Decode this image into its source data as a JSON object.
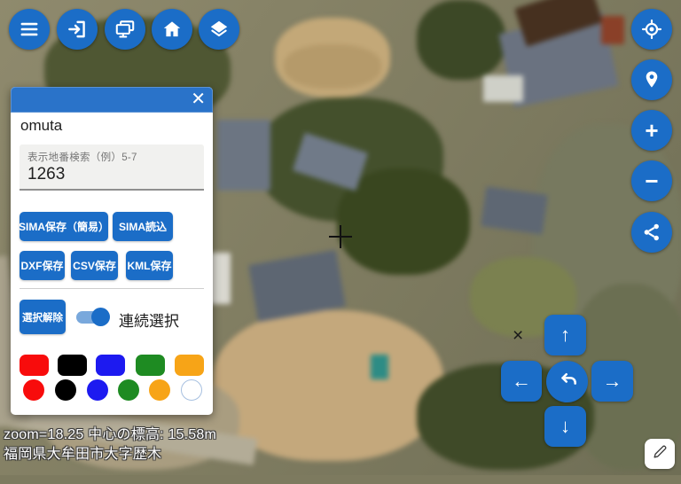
{
  "panel": {
    "title": "omuta",
    "close_glyph": "✕",
    "search": {
      "label": "表示地番検索（例）5-7",
      "value": "1263"
    },
    "save_buttons": [
      {
        "label": "SIMA保存（簡易）"
      },
      {
        "label": "SIMA読込"
      }
    ],
    "export_buttons": [
      {
        "label": "DXF保存"
      },
      {
        "label": "CSV保存"
      },
      {
        "label": "KML保存"
      }
    ],
    "clear_selection_label": "選択解除",
    "toggle": {
      "label": "連続選択",
      "state": "on"
    },
    "swatch_rects": [
      "#f80c0c",
      "#000000",
      "#1d1af0",
      "#1e8b22",
      "#f7a417"
    ],
    "swatch_circles": [
      "#f80c0c",
      "#000000",
      "#1d1af0",
      "#1e8b22",
      "#f7a417",
      "#ffffff"
    ]
  },
  "toolbar_top": {
    "items": [
      {
        "icon": "menu-icon"
      },
      {
        "icon": "login-icon"
      },
      {
        "icon": "displays-icon"
      },
      {
        "icon": "home-icon"
      },
      {
        "icon": "layers-icon"
      }
    ]
  },
  "toolbar_right": {
    "items": [
      {
        "icon": "gps-locate-icon"
      },
      {
        "icon": "place-pin-icon"
      },
      {
        "icon": "zoom-in-icon",
        "glyph": "+"
      },
      {
        "icon": "zoom-out-icon",
        "glyph": "−"
      },
      {
        "icon": "share-icon"
      }
    ]
  },
  "nav_pad": {
    "up_glyph": "↑",
    "left_glyph": "←",
    "right_glyph": "→",
    "down_glyph": "↓",
    "center_icon": "undo-icon"
  },
  "edit_button": {
    "icon": "pencil-icon"
  },
  "markers": {
    "x_marker_glyph": "×",
    "crosshair": "+"
  },
  "status": {
    "line1": "zoom=18.25 中心の標高: 15.58m",
    "line2": "福岡県大牟田市大字歴木"
  },
  "colors": {
    "accent_blue": "#1b6dc7",
    "header_blue": "#2a73c9",
    "toggle_track_blue": "#79a8dc"
  }
}
